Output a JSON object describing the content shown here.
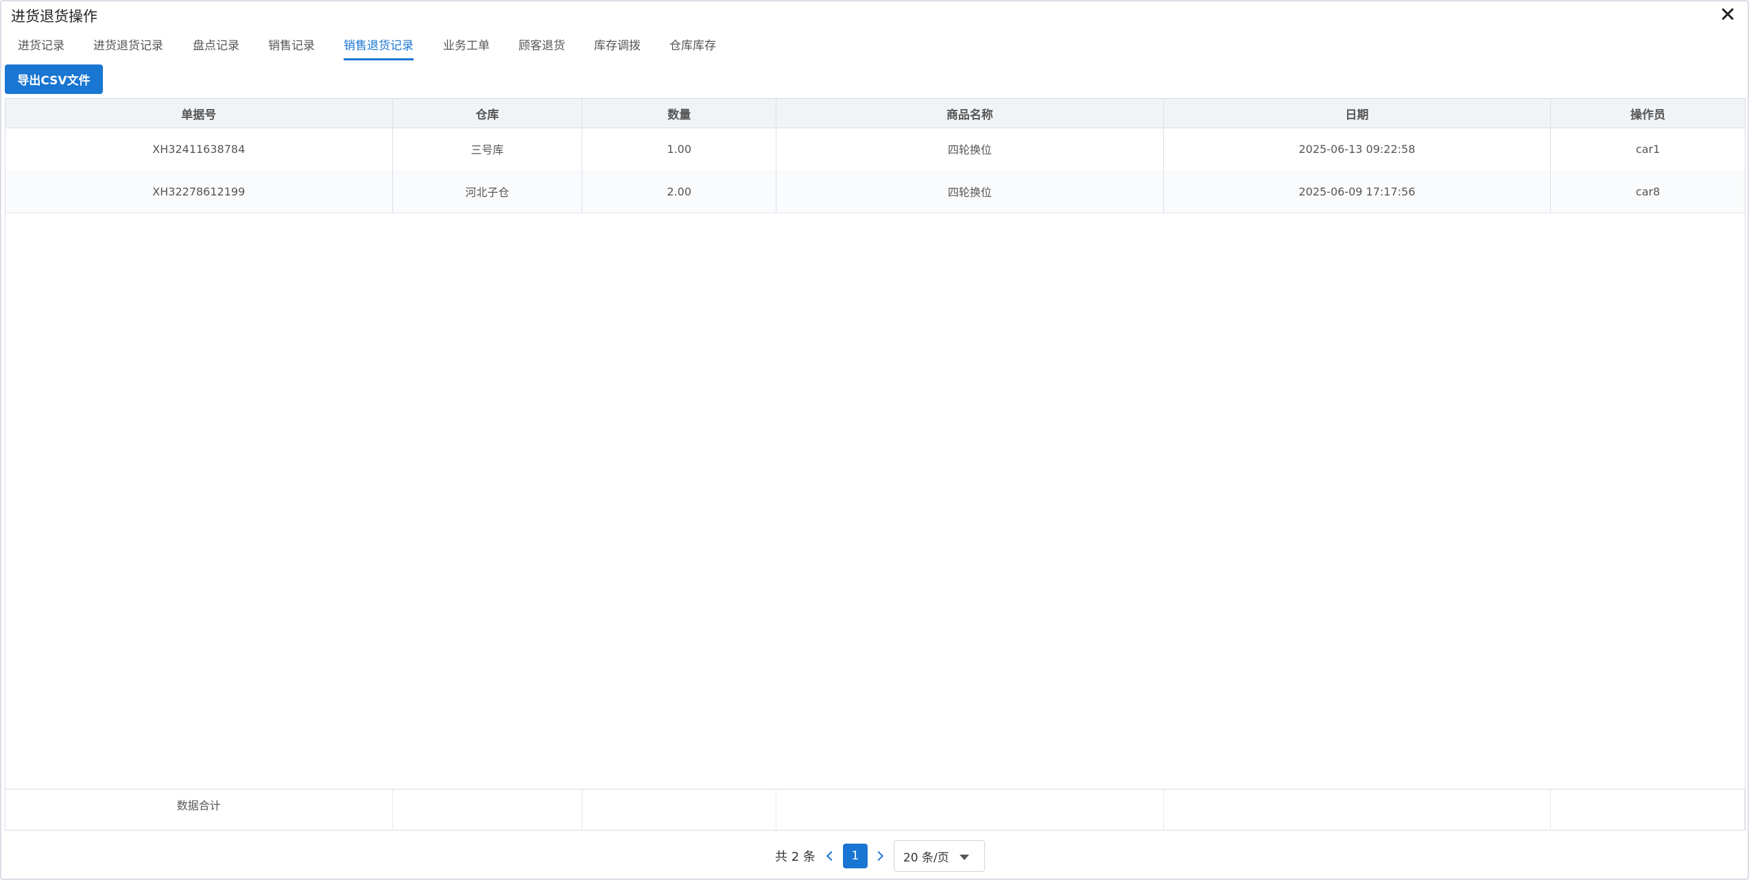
{
  "dialog": {
    "title": "进货退货操作"
  },
  "tabs": [
    {
      "label": "进货记录"
    },
    {
      "label": "进货退货记录"
    },
    {
      "label": "盘点记录"
    },
    {
      "label": "销售记录"
    },
    {
      "label": "销售退货记录",
      "active": true
    },
    {
      "label": "业务工单"
    },
    {
      "label": "顾客退货"
    },
    {
      "label": "库存调拨"
    },
    {
      "label": "仓库库存"
    }
  ],
  "toolbar": {
    "export_label": "导出CSV文件"
  },
  "table": {
    "columns": [
      "单据号",
      "仓库",
      "数量",
      "商品名称",
      "日期",
      "操作员"
    ],
    "rows": [
      [
        "XH32411638784",
        "三号库",
        "1.00",
        "四轮换位",
        "2025-06-13 09:22:58",
        "car1"
      ],
      [
        "XH32278612199",
        "河北子仓",
        "2.00",
        "四轮换位",
        "2025-06-09 17:17:56",
        "car8"
      ]
    ],
    "footer_label": "数据合计"
  },
  "pagination": {
    "total_text": "共 2 条",
    "current_page": "1",
    "page_size": "20 条/页"
  },
  "colors": {
    "accent": "#1976d2"
  }
}
